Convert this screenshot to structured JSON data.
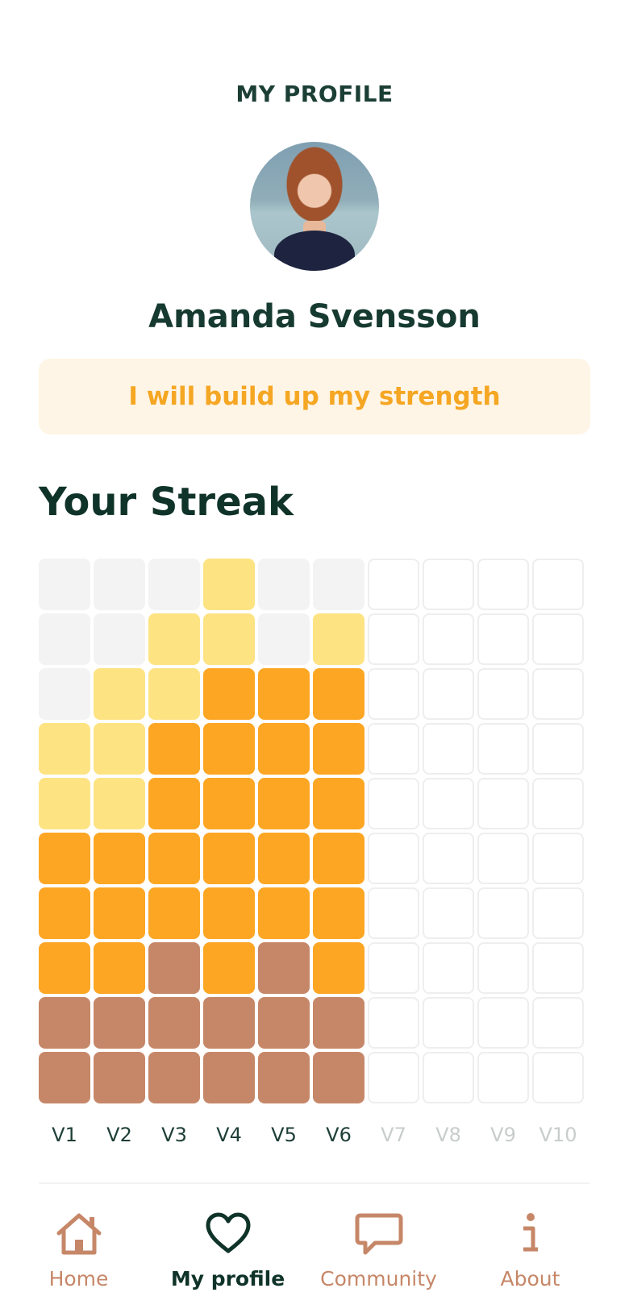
{
  "header": {
    "title": "MY PROFILE"
  },
  "profile": {
    "name": "Amanda Svensson",
    "goal": "I will build up my strength"
  },
  "streak": {
    "title": "Your Streak",
    "weeks": [
      "V1",
      "V2",
      "V3",
      "V4",
      "V5",
      "V6",
      "V7",
      "V8",
      "V9",
      "V10"
    ],
    "completed_weeks": 6,
    "grid_rows": [
      [
        "e",
        "e",
        "e",
        "y",
        "e",
        "e",
        "n",
        "n",
        "n",
        "n"
      ],
      [
        "e",
        "e",
        "y",
        "y",
        "e",
        "y",
        "n",
        "n",
        "n",
        "n"
      ],
      [
        "e",
        "y",
        "y",
        "o",
        "o",
        "o",
        "n",
        "n",
        "n",
        "n"
      ],
      [
        "y",
        "y",
        "o",
        "o",
        "o",
        "o",
        "n",
        "n",
        "n",
        "n"
      ],
      [
        "y",
        "y",
        "o",
        "o",
        "o",
        "o",
        "n",
        "n",
        "n",
        "n"
      ],
      [
        "o",
        "o",
        "o",
        "o",
        "o",
        "o",
        "n",
        "n",
        "n",
        "n"
      ],
      [
        "o",
        "o",
        "o",
        "o",
        "o",
        "o",
        "n",
        "n",
        "n",
        "n"
      ],
      [
        "o",
        "o",
        "b",
        "o",
        "b",
        "o",
        "n",
        "n",
        "n",
        "n"
      ],
      [
        "b",
        "b",
        "b",
        "b",
        "b",
        "b",
        "n",
        "n",
        "n",
        "n"
      ],
      [
        "b",
        "b",
        "b",
        "b",
        "b",
        "b",
        "n",
        "n",
        "n",
        "n"
      ]
    ],
    "colors": {
      "e": "#f4f3f4",
      "y": "#fde382",
      "o": "#fca624",
      "b": "#c68768",
      "n": "#ffffff"
    }
  },
  "nav": {
    "items": [
      {
        "label": "Home",
        "icon": "home-icon",
        "active": false
      },
      {
        "label": "My profile",
        "icon": "heart-icon",
        "active": true
      },
      {
        "label": "Community",
        "icon": "chat-bubble-icon",
        "active": false
      },
      {
        "label": "About",
        "icon": "info-icon",
        "active": false
      }
    ],
    "accent_color": "#c68768",
    "active_color": "#0f3329"
  }
}
